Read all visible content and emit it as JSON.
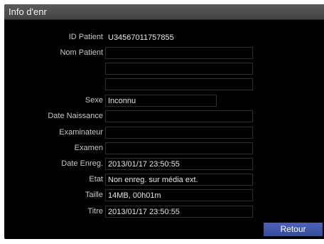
{
  "window": {
    "title": "Info d'enr"
  },
  "form": {
    "rows": [
      {
        "label": "ID Patient",
        "value": "U34567011757855"
      },
      {
        "label": "Nom Patient",
        "value": ""
      },
      {
        "label": "",
        "value": ""
      },
      {
        "label": "",
        "value": ""
      },
      {
        "label": "Sexe",
        "value": "Inconnu"
      },
      {
        "label": "Date Naissance",
        "value": ""
      },
      {
        "label": "Examinateur",
        "value": ""
      },
      {
        "label": "Examen",
        "value": ""
      },
      {
        "label": "Date Enreg.",
        "value": "2013/01/17 23:50:55"
      },
      {
        "label": "Etat",
        "value": "Non enreg. sur média ext."
      },
      {
        "label": "Taille",
        "value": "14MB, 00h01m"
      },
      {
        "label": "Titre",
        "value": "2013/01/17 23:50:55"
      }
    ]
  },
  "buttons": {
    "back_label": "Retour",
    "accent": "#3f57ab"
  }
}
